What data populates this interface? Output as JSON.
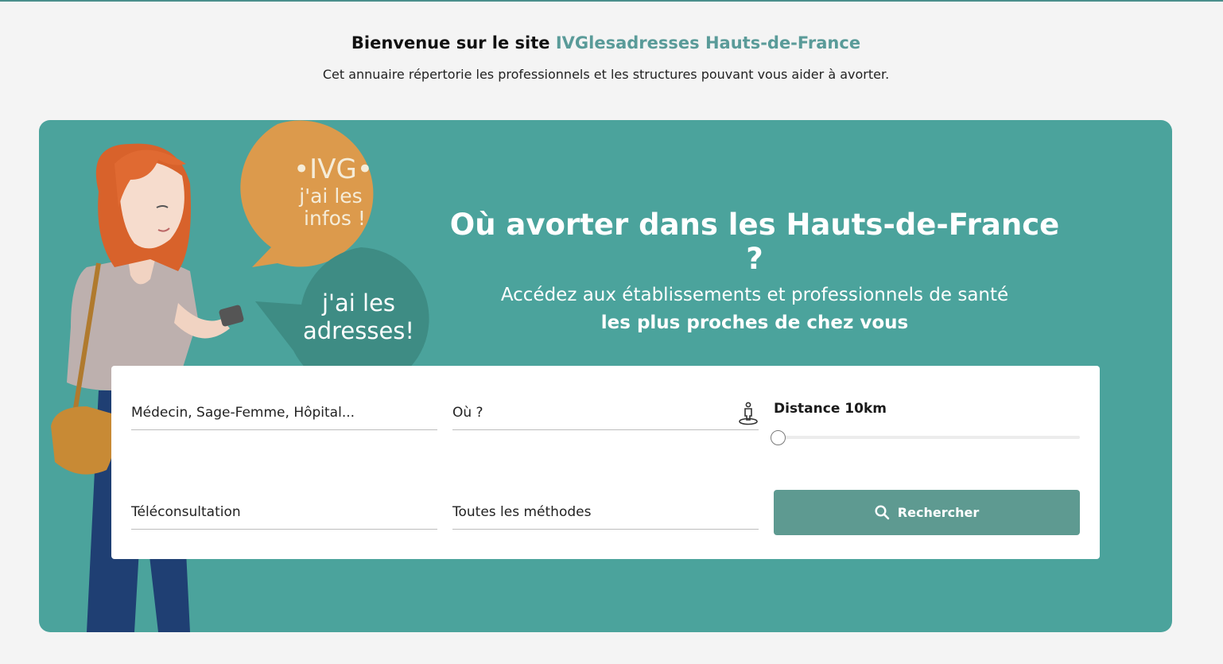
{
  "header": {
    "welcome_prefix": "Bienvenue sur le site ",
    "welcome_brand": "IVGlesadresses Hauts-de-France",
    "subtitle": "Cet annuaire répertorie les professionnels et les structures pouvant vous aider à avorter."
  },
  "hero": {
    "bubble1_line1": "•IVG•",
    "bubble1_line2": "j'ai les",
    "bubble1_line3": "infos !",
    "bubble2_line1": "j'ai les",
    "bubble2_line2": "adresses!",
    "title": "Où avorter dans les Hauts-de-France ?",
    "subtitle_line1": "Accédez aux établissements et professionnels de santé",
    "subtitle_line2": "les plus proches de chez vous"
  },
  "search": {
    "type_placeholder": "Médecin, Sage-Femme, Hôpital...",
    "where_placeholder": "Où ?",
    "distance_label": "Distance 10km",
    "distance_fraction": 0.0,
    "teleconsultation_label": "Téléconsultation",
    "method_label": "Toutes les méthodes",
    "search_button": "Rechercher"
  },
  "colors": {
    "brand": "#5a9b99",
    "hero_bg": "#4ba39c",
    "button_bg": "#5e9a91",
    "bubble_orange": "#dc9a4c",
    "bubble_green": "#3e8c84"
  }
}
